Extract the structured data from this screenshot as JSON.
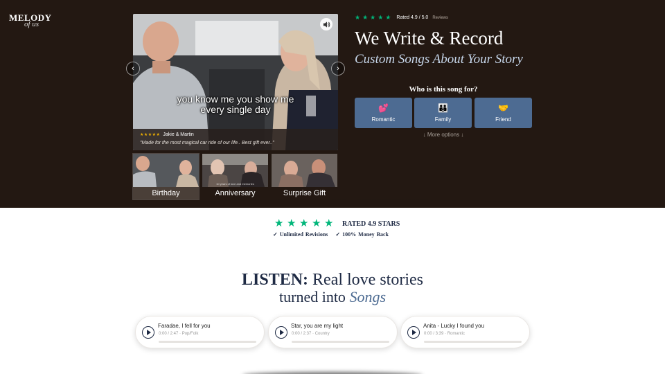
{
  "brand": {
    "line1": "MELODY",
    "line2": "of us"
  },
  "hero": {
    "video": {
      "caption_line1": "you know me you show me",
      "caption_line2": "every single day",
      "review_stars": "★★★★★",
      "review_name": "Jakie & Martin",
      "review_quote": "\"Made for the most magical car ride of our life.. Best gift ever..\"",
      "prev_icon": "chevron-left-icon",
      "next_icon": "chevron-right-icon",
      "sound_icon": "speaker-icon"
    },
    "thumbnails": [
      {
        "label": "Birthday",
        "active": true
      },
      {
        "label": "Anniversary",
        "active": false,
        "overlay": "10 years of love and memories"
      },
      {
        "label": "Surprise Gift",
        "active": false
      }
    ],
    "rating_text": "Rated 4.9 / 5.0",
    "reviews_label": "Reviews",
    "headline": "We Write & Record",
    "subheadline": "Custom Songs About Your Story",
    "question": "Who is this song for?",
    "options": [
      {
        "icon": "💕",
        "label": "Romantic"
      },
      {
        "icon": "👪",
        "label": "Family"
      },
      {
        "icon": "🤝",
        "label": "Friend"
      }
    ],
    "more_options": "↓ More options ↓"
  },
  "trust": {
    "rated": "RATED 4.9 STARS",
    "benefit1": "✓ Unlimited Revisions",
    "benefit2": "✓ 100% Money Back"
  },
  "listen": {
    "heading_bold": "LISTEN:",
    "heading_rest": " Real love stories",
    "line2_plain": "turned into ",
    "line2_italic": "Songs"
  },
  "players": [
    {
      "title": "Faradae, I fell for you",
      "time": "0:00 / 2:47",
      "genre": "Pop/Folk"
    },
    {
      "title": "Star, you are my light",
      "time": "0:00 / 2:37",
      "genre": "Country"
    },
    {
      "title": "Anita - Lucky I found you",
      "time": "0:00 / 3:39",
      "genre": "Romantic"
    }
  ],
  "colors": {
    "hero_bg": "#231812",
    "accent_blue": "#4d6b92",
    "trust_green": "#00b67a",
    "navy": "#1e2a44"
  }
}
